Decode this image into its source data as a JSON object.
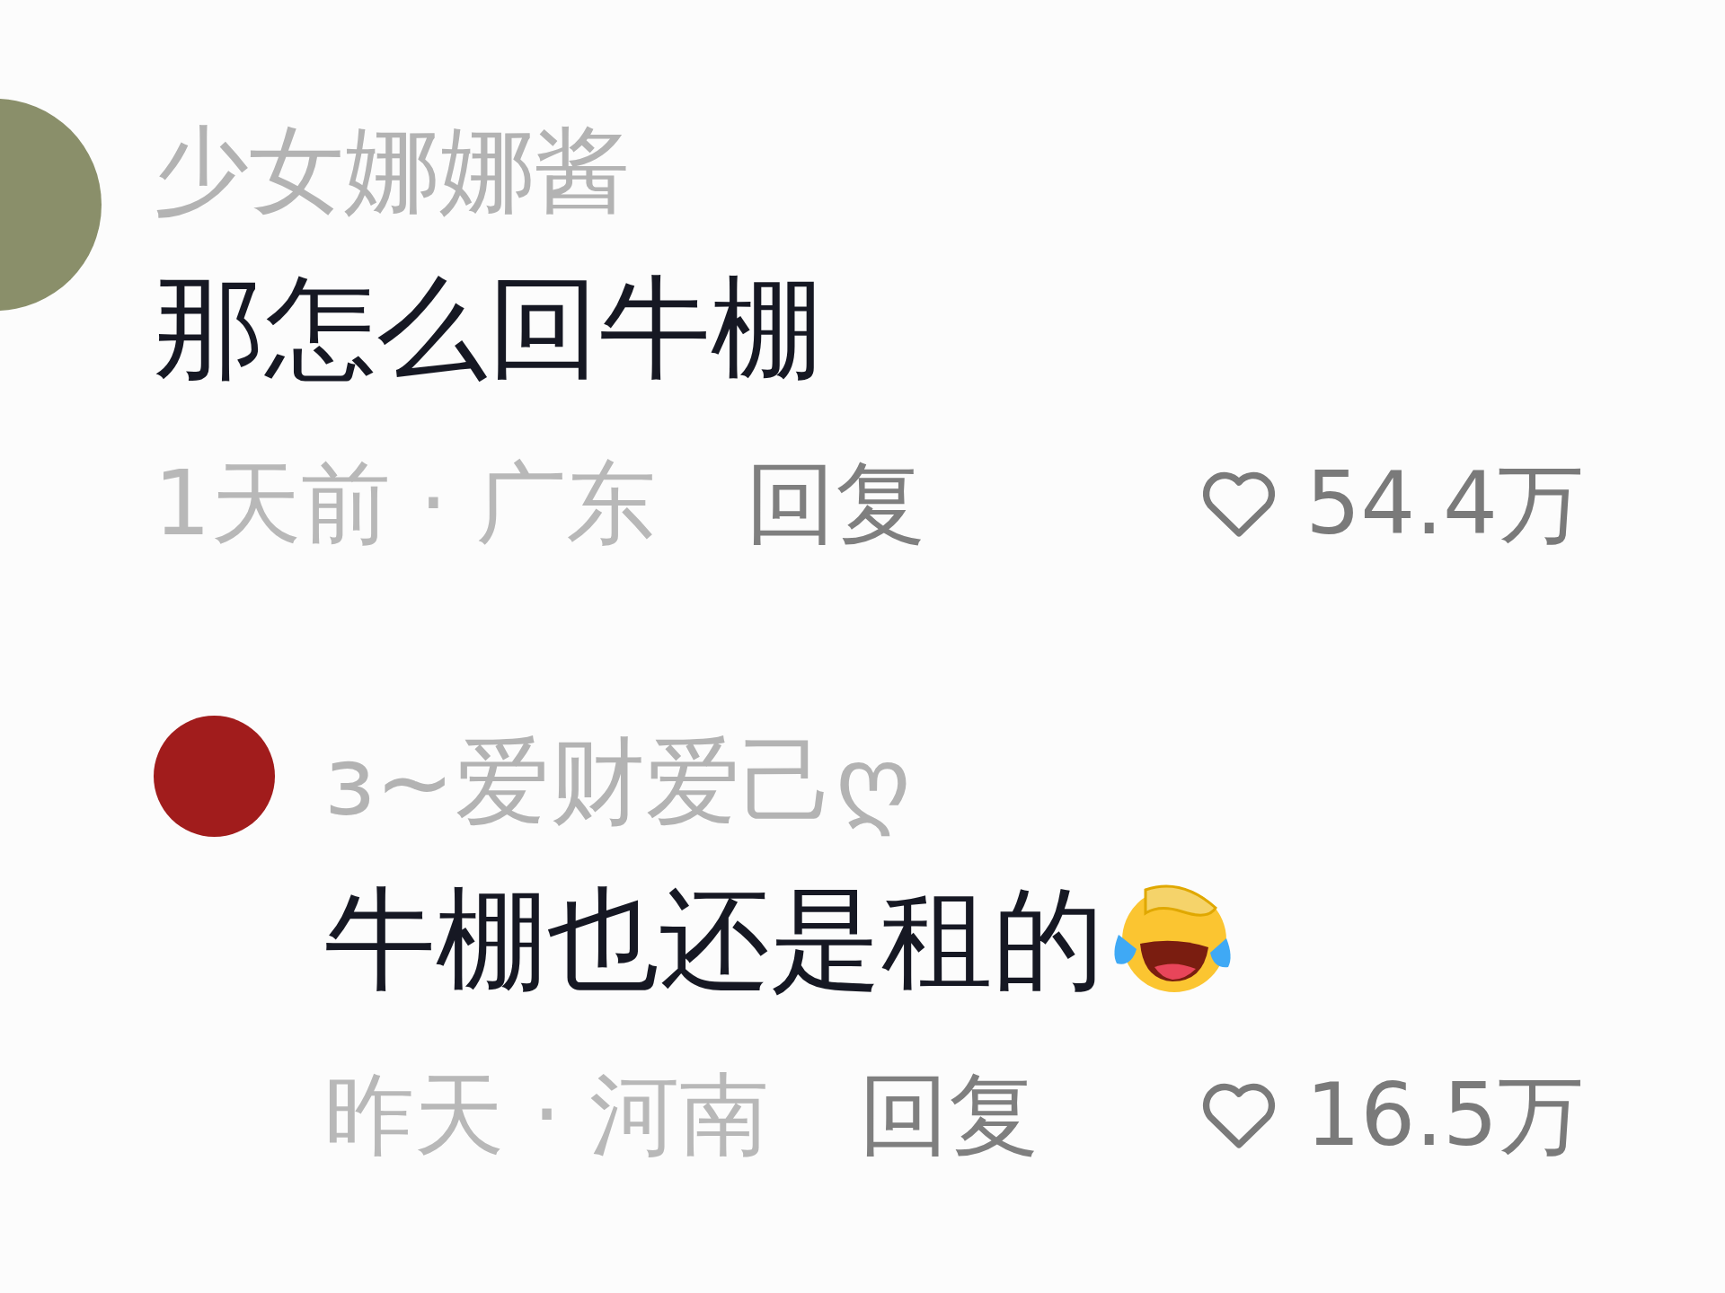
{
  "comments": [
    {
      "author": "少女娜娜酱",
      "text": "那怎么回牛棚",
      "time_location": "1天前 · 广东",
      "reply_label": "回复",
      "likes": "54.4万",
      "replies": [
        {
          "author": "ɜ~爱财爱己ღ",
          "text": "牛棚也还是租的",
          "emoji": true,
          "time_location": "昨天 · 河南",
          "reply_label": "回复",
          "likes": "16.5万"
        }
      ]
    }
  ]
}
